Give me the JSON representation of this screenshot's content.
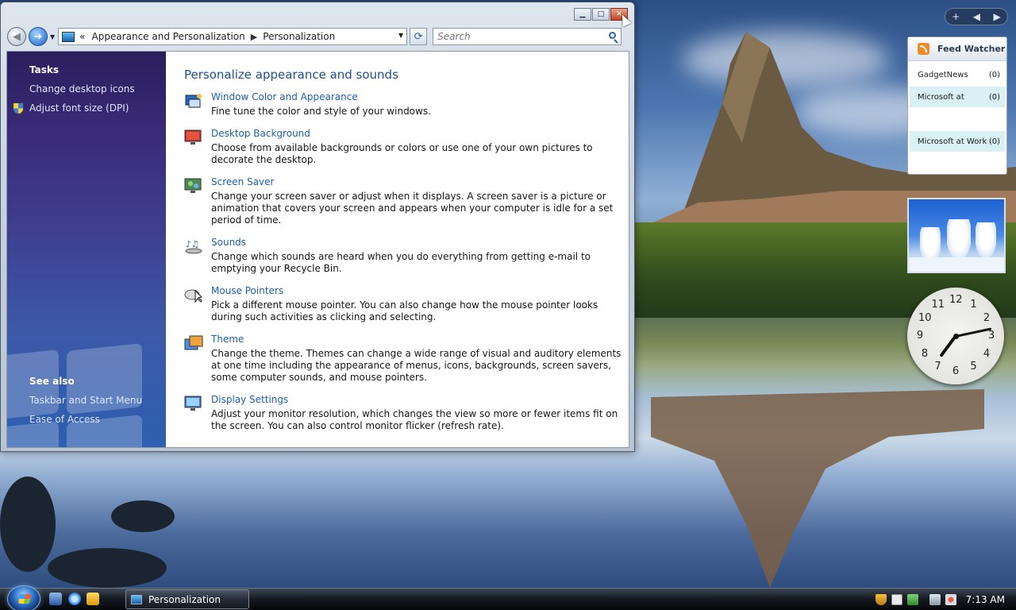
{
  "window": {
    "title_controls": {
      "minimize": "▁",
      "maximize": "□",
      "close": "✕"
    },
    "nav": {
      "back_glyph": "◀",
      "forward_glyph": "➔",
      "dropdown_glyph": "▼",
      "breadcrumb_prefix": "«",
      "breadcrumb": [
        "Appearance and Personalization",
        "Personalization"
      ],
      "breadcrumb_sep": "▶",
      "refresh_glyph": "⟳",
      "search_placeholder": "Search"
    },
    "tasks": {
      "heading": "Tasks",
      "links": [
        "Change desktop icons",
        "Adjust font size (DPI)"
      ]
    },
    "see_also": {
      "heading": "See also",
      "links": [
        "Taskbar and Start Menu",
        "Ease of Access"
      ]
    },
    "main": {
      "title": "Personalize appearance and sounds",
      "items": [
        {
          "icon": "window-color-icon",
          "title": "Window Color and Appearance",
          "desc": "Fine tune the color and style of your windows."
        },
        {
          "icon": "desktop-background-icon",
          "title": "Desktop Background",
          "desc": "Choose from available backgrounds or colors or use one of your own pictures to decorate the desktop."
        },
        {
          "icon": "screen-saver-icon",
          "title": "Screen Saver",
          "desc": "Change your screen saver or adjust when it displays. A screen saver is a picture or animation that covers your screen and appears when your computer is idle for a set period of time."
        },
        {
          "icon": "sounds-icon",
          "title": "Sounds",
          "desc": "Change which sounds are heard when you do everything from getting e-mail to emptying your Recycle Bin."
        },
        {
          "icon": "mouse-pointers-icon",
          "title": "Mouse Pointers",
          "desc": "Pick a different mouse pointer. You can also change how the mouse pointer looks during such activities as clicking and selecting."
        },
        {
          "icon": "theme-icon",
          "title": "Theme",
          "desc": "Change the theme. Themes can change a wide range of visual and auditory elements at one time including the appearance of menus, icons, backgrounds, screen savers, some computer sounds, and mouse pointers."
        },
        {
          "icon": "display-settings-icon",
          "title": "Display Settings",
          "desc": "Adjust your monitor resolution, which changes the view so more or fewer items fit on the screen. You can also control monitor flicker (refresh rate)."
        }
      ]
    }
  },
  "sidebar": {
    "controls": {
      "add": "+",
      "prev": "◀",
      "next": "▶"
    },
    "feed_watcher": {
      "title": "Feed Watcher",
      "rows": [
        {
          "name": "GadgetNews",
          "count": "(0)"
        },
        {
          "name": "Microsoft at",
          "count": "(0)"
        },
        {
          "name": "Microsoft at Work",
          "count": "(0)"
        }
      ]
    },
    "clock": {
      "numbers": [
        "12",
        "1",
        "2",
        "3",
        "4",
        "5",
        "6",
        "7",
        "8",
        "9",
        "10",
        "11"
      ],
      "hour": 7,
      "minute": 13
    }
  },
  "taskbar": {
    "task_button": "Personalization",
    "time": "7:13 AM"
  },
  "colors": {
    "link": "#1c5fad",
    "title": "#1d4f90"
  }
}
